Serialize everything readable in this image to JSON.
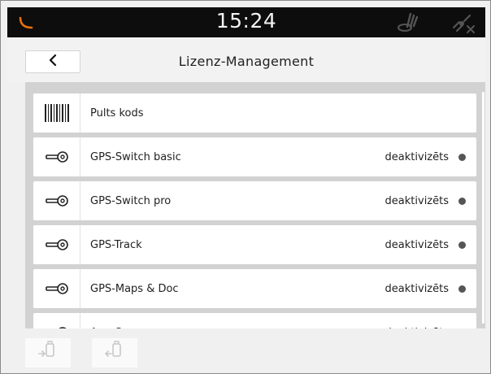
{
  "status_bar": {
    "time": "15:24",
    "left_icon": "tractor-indicator-icon",
    "gps_icon": "gps-signal-icon",
    "connection_icon": "no-connection-icon"
  },
  "header": {
    "back_icon": "chevron-left-icon",
    "title": "Lizenz-Management"
  },
  "licenses": [
    {
      "label": "Pults kods",
      "icon": "barcode-icon",
      "status": ""
    },
    {
      "label": "GPS-Switch basic",
      "icon": "key-icon",
      "status": "deaktivizēts"
    },
    {
      "label": "GPS-Switch pro",
      "icon": "key-icon",
      "status": "deaktivizēts"
    },
    {
      "label": "GPS-Track",
      "icon": "key-icon",
      "status": "deaktivizēts"
    },
    {
      "label": "GPS-Maps & Doc",
      "icon": "key-icon",
      "status": "deaktivizēts"
    },
    {
      "label": "AmaCam",
      "icon": "key-icon",
      "status": "deaktivizēts"
    }
  ],
  "footer": {
    "buttons": [
      "import-license-icon",
      "export-license-icon"
    ]
  },
  "colors": {
    "accent": "#e8710a",
    "status_dot": "#555555",
    "list_background": "#d2d2d2"
  }
}
